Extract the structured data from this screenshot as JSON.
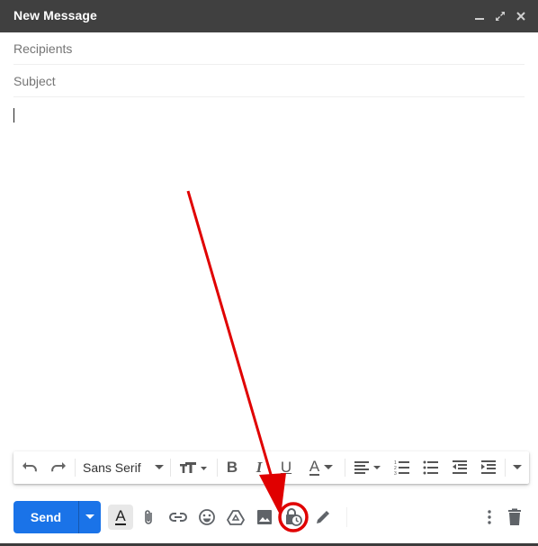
{
  "window": {
    "title": "New Message",
    "controls": {
      "minimize": "minimize-icon",
      "fullscreen": "expand-icon",
      "close": "close-icon"
    }
  },
  "fields": {
    "recipients": {
      "placeholder": "Recipients",
      "value": ""
    },
    "subject": {
      "placeholder": "Subject",
      "value": ""
    }
  },
  "body": {
    "value": ""
  },
  "formatting_toolbar": {
    "undo": "undo-icon",
    "redo": "redo-icon",
    "font_family": "Sans Serif",
    "font_size": "text-size-icon",
    "bold": "B",
    "italic": "I",
    "underline": "U",
    "text_color": "A",
    "align": "align-left-icon",
    "numbered_list": "numbered-list-icon",
    "bulleted_list": "bulleted-list-icon",
    "indent_less": "indent-less-icon",
    "indent_more": "indent-more-icon",
    "more": "more-formatting-icon"
  },
  "bottom_toolbar": {
    "send_label": "Send",
    "send_options": "chevron-down-icon",
    "formatting_options_active": true,
    "items": [
      {
        "name": "formatting-options",
        "label": "A"
      },
      {
        "name": "attach-files",
        "label": "attachment-icon"
      },
      {
        "name": "insert-link",
        "label": "link-icon"
      },
      {
        "name": "insert-emoji",
        "label": "emoji-icon"
      },
      {
        "name": "insert-from-drive",
        "label": "drive-icon"
      },
      {
        "name": "insert-photo",
        "label": "photo-icon"
      },
      {
        "name": "confidential-mode",
        "label": "confidential-lock-clock-icon",
        "highlighted": true
      },
      {
        "name": "insert-signature",
        "label": "pen-icon"
      }
    ],
    "more_options": "more-vert-icon",
    "discard": "trash-icon"
  },
  "annotation": {
    "type": "arrow-and-circle",
    "color": "#e00000",
    "target": "confidential-mode"
  }
}
